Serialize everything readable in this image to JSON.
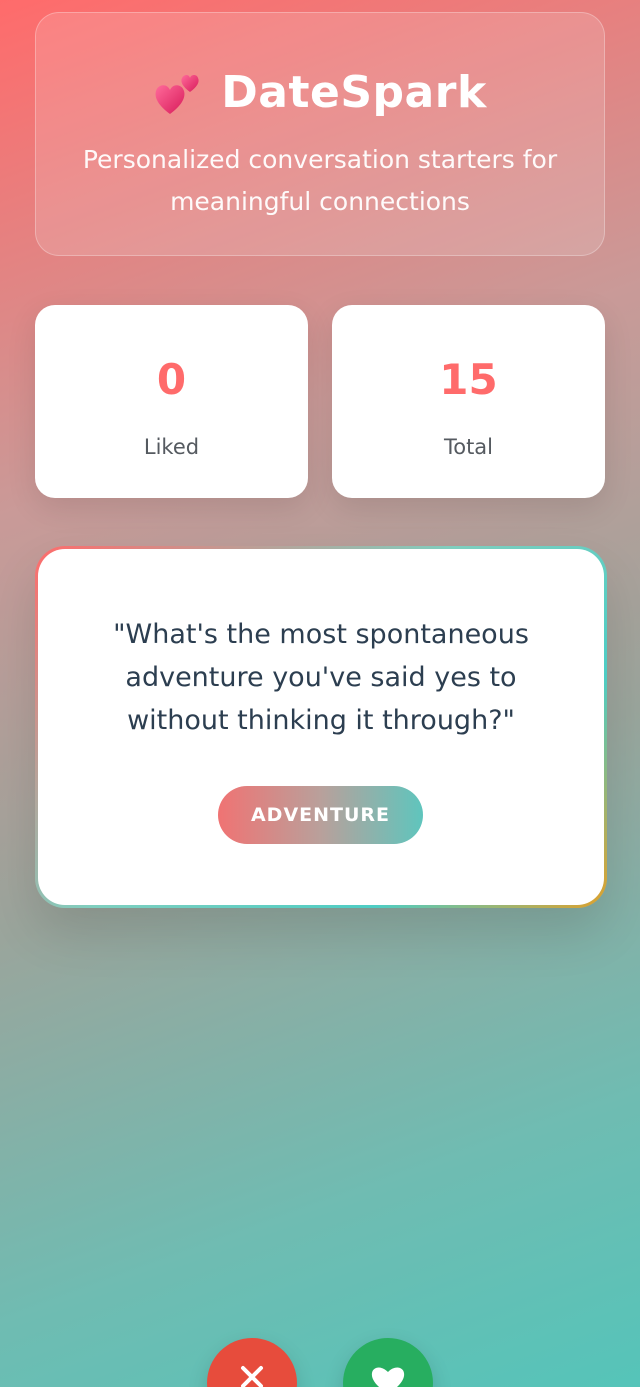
{
  "header": {
    "icon": "two-hearts-icon",
    "title": "DateSpark",
    "tagline": "Personalized conversation starters for meaningful connections"
  },
  "stats": {
    "liked": {
      "value": "0",
      "label": "Liked"
    },
    "total": {
      "value": "15",
      "label": "Total"
    }
  },
  "prompt": {
    "question": "\"What's the most spontaneous adventure you've said yes to without thinking it through?\"",
    "category": "ADVENTURE"
  },
  "actions": {
    "skip_icon": "close-icon",
    "like_icon": "heart-icon"
  },
  "colors": {
    "accent": "#ff6b6b",
    "teal": "#4ecdc4",
    "skip": "#e74c3c",
    "like": "#27ae60",
    "text_dark": "#2c3e50"
  }
}
